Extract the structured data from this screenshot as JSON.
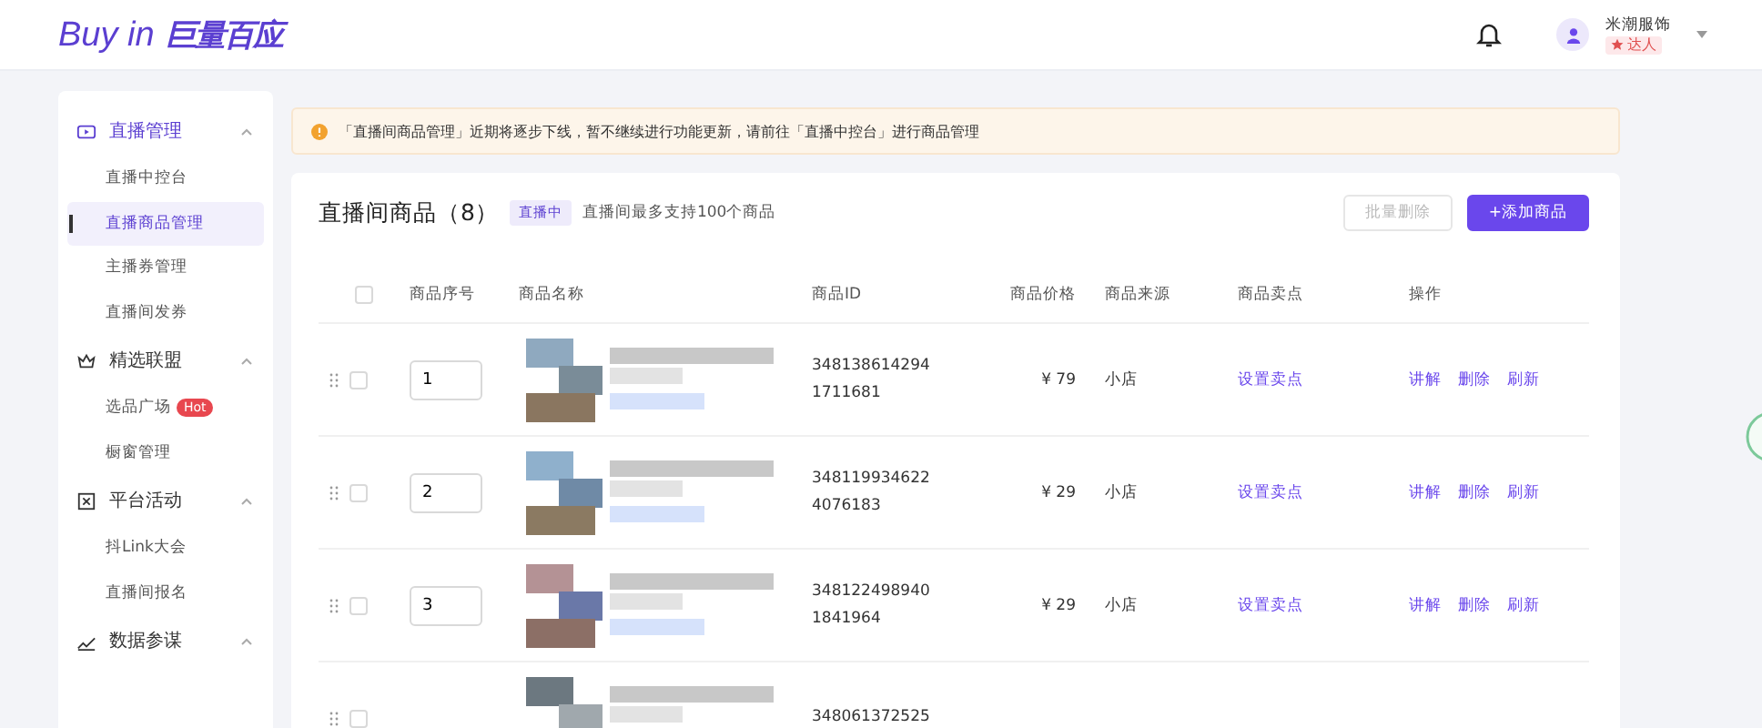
{
  "header": {
    "logo_latin": "Buy in",
    "logo_cn": "巨量百应",
    "user": {
      "name": "米潮服饰",
      "role": "达人"
    }
  },
  "sidebar": {
    "groups": [
      {
        "label": "直播管理",
        "expanded": true,
        "items": [
          {
            "label": "直播中控台",
            "selected": false
          },
          {
            "label": "直播商品管理",
            "selected": true
          },
          {
            "label": "主播券管理",
            "selected": false
          },
          {
            "label": "直播间发券",
            "selected": false
          }
        ]
      },
      {
        "label": "精选联盟",
        "expanded": true,
        "items": [
          {
            "label": "选品广场",
            "badge": "Hot",
            "selected": false
          },
          {
            "label": "橱窗管理",
            "selected": false
          }
        ]
      },
      {
        "label": "平台活动",
        "expanded": true,
        "items": [
          {
            "label": "抖Link大会",
            "selected": false
          },
          {
            "label": "直播间报名",
            "selected": false
          }
        ]
      },
      {
        "label": "数据参谋",
        "expanded": true
      }
    ]
  },
  "notice": "「直播间商品管理」近期将逐步下线，暂不继续进行功能更新，请前往「直播中控台」进行商品管理",
  "panel": {
    "title": "直播间商品（8）",
    "status_tag": "直播中",
    "hint": "直播间最多支持100个商品",
    "buttons": [
      {
        "label": "批量删除",
        "kind": "secondary",
        "disabled": true
      },
      {
        "label": "+添加商品",
        "kind": "primary",
        "disabled": false
      }
    ]
  },
  "table": {
    "all_checked": false,
    "columns": [
      "商品序号",
      "商品名称",
      "商品ID",
      "商品价格",
      "商品来源",
      "商品卖点",
      "操作"
    ],
    "rows": [
      {
        "seq": "1",
        "id": [
          "348138614294",
          "1711681"
        ],
        "price": "¥ 79",
        "source": "小店",
        "sell_point": "设置卖点",
        "actions": [
          "讲解",
          "删除",
          "刷新"
        ],
        "checked": false
      },
      {
        "seq": "2",
        "id": [
          "348119934622",
          "4076183"
        ],
        "price": "¥ 29",
        "source": "小店",
        "sell_point": "设置卖点",
        "actions": [
          "讲解",
          "删除",
          "刷新"
        ],
        "checked": false
      },
      {
        "seq": "3",
        "id": [
          "348122498940",
          "1841964"
        ],
        "price": "¥ 29",
        "source": "小店",
        "sell_point": "设置卖点",
        "actions": [
          "讲解",
          "删除",
          "刷新"
        ],
        "checked": false
      },
      {
        "id": [
          "348061372525"
        ],
        "actions": [],
        "checked": false
      }
    ]
  }
}
